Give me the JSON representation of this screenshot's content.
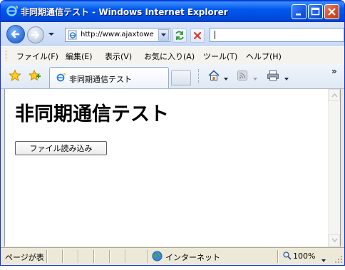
{
  "window": {
    "title": "非同期通信テスト - Windows Internet Explorer"
  },
  "address": {
    "url": "http://www.ajaxtowe",
    "search_value": ""
  },
  "menu": {
    "items": [
      {
        "label": "ファイル(F)"
      },
      {
        "label": "編集(E)"
      },
      {
        "label": "表示(V)"
      },
      {
        "label": "お気に入り(A)"
      },
      {
        "label": "ツール(T)"
      },
      {
        "label": "ヘルプ(H)"
      }
    ]
  },
  "tabbar": {
    "active_tab_label": "非同期通信テスト",
    "overflow_chevron": "»"
  },
  "content": {
    "heading": "非同期通信テスト",
    "button_label": "ファイル読み込み"
  },
  "status": {
    "text": "ページが表",
    "zone": "インターネット",
    "zoom": "100%"
  },
  "icons": {
    "title": "ie-logo-icon",
    "back": "back-arrow-icon",
    "forward": "forward-arrow-icon",
    "page": "ie-page-icon",
    "refresh": "refresh-icon",
    "stop": "stop-icon",
    "favorites": "favorites-star-icon",
    "add_favorites": "add-favorites-icon",
    "home": "home-icon",
    "feeds": "feeds-icon",
    "print": "print-icon",
    "zone": "globe-icon",
    "zoom": "zoom-icon"
  },
  "colors": {
    "titlebar": "#0058ee",
    "close_button": "#d2502a",
    "chrome": "#ece9d8"
  }
}
